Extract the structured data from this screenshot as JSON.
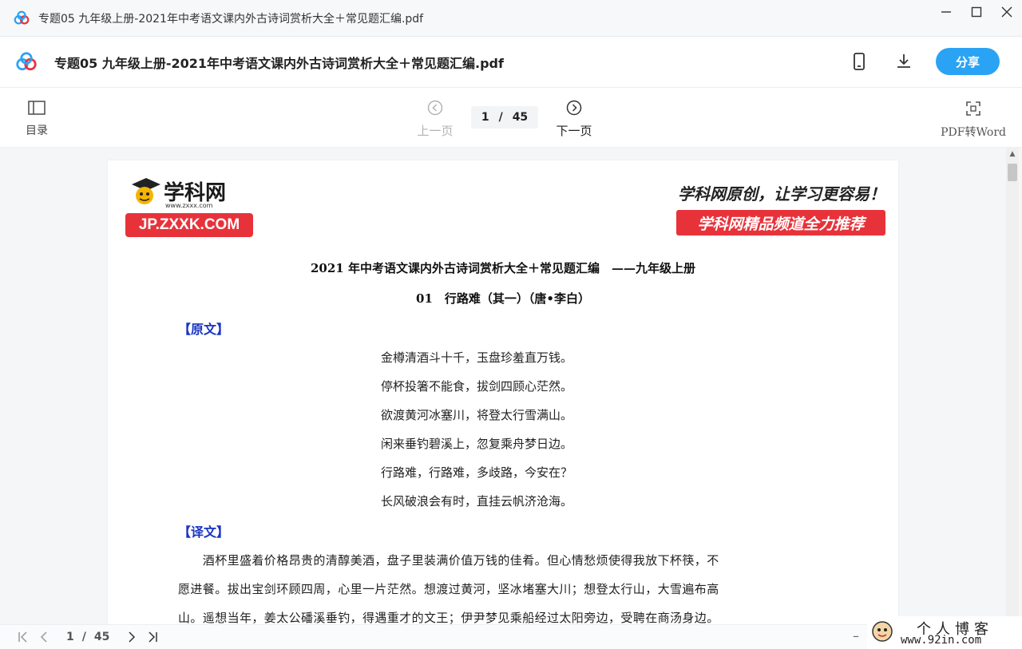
{
  "window": {
    "title": "专题05 九年级上册-2021年中考语文课内外古诗词赏析大全＋常见题汇编.pdf",
    "minimize_icon": "minimize-icon",
    "maximize_icon": "maximize-icon",
    "close_icon": "close-icon"
  },
  "header": {
    "doc_title": "专题05 九年级上册-2021年中考语文课内外古诗词赏析大全＋常见题汇编.pdf",
    "share_label": "分享",
    "accent_color": "#2aa3f5"
  },
  "toolbar": {
    "toc_label": "目录",
    "prev_label": "上一页",
    "next_label": "下一页",
    "current_page": "1",
    "separator": "/",
    "total_pages": "45",
    "pdf_to_word_label": "PDF转Word"
  },
  "document": {
    "logo_text": "学科网",
    "logo_url": "www.zxxx.com",
    "logo_badge": "JP.ZXXK.COM",
    "slogan": "学科网原创，让学习更容易！",
    "banner": "学科网精品频道全力推荐",
    "heading": "2021 年中考语文课内外古诗词赏析大全＋常见题汇编　——九年级上册",
    "subheading": "01　行路难（其一）（唐•李白）",
    "section_original": "【原文】",
    "poem": [
      "金樽清酒斗十千，玉盘珍羞直万钱。",
      "停杯投箸不能食，拔剑四顾心茫然。",
      "欲渡黄河冰塞川，将登太行雪满山。",
      "闲来垂钓碧溪上，忽复乘舟梦日边。",
      "行路难，行路难，多歧路，今安在？",
      "长风破浪会有时，直挂云帆济沧海。"
    ],
    "section_translation": "【译文】",
    "translation_lines": [
      "　　酒杯里盛着价格昂贵的清醇美酒，盘子里装满价值万钱的佳肴。但心情愁烦使得我放下杯筷，不",
      "愿进餐。拔出宝剑环顾四周，心里一片茫然。想渡过黄河，坚冰堵塞大川；想登太行山，大雪遍布高",
      "山。遥想当年，姜太公磻溪垂钓，得遇重才的文王；伊尹梦见乘船经过太阳旁边，受聘在商汤身边。"
    ],
    "brand_red": "#e8323a",
    "section_color": "#1a35c0"
  },
  "bottombar": {
    "current_page": "1",
    "separator": "/",
    "total_pages": "45",
    "zoom_out_label": "–"
  },
  "watermark": {
    "title": "个人博客",
    "url": "www.92in.com"
  }
}
